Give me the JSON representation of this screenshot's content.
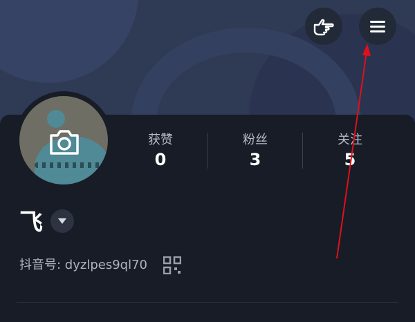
{
  "header": {
    "hand_icon": "pointing-hand-icon",
    "menu_icon": "hamburger-menu-icon"
  },
  "profile": {
    "avatar_overlay_icon": "camera-icon",
    "username": "飞",
    "douyin_id_label": "抖音号: ",
    "douyin_id": "dyzlpes9ql70",
    "qr_icon": "qr-code-icon"
  },
  "stats": [
    {
      "label": "获赞",
      "value": "0"
    },
    {
      "label": "粉丝",
      "value": "3"
    },
    {
      "label": "关注",
      "value": "5"
    }
  ],
  "annotation": {
    "arrow_color": "#e0101a"
  }
}
